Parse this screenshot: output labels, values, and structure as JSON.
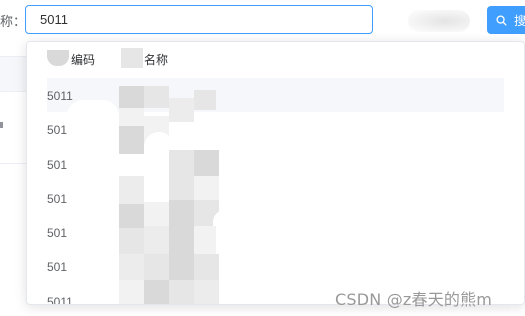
{
  "filter": {
    "label": "称：",
    "value": "5011",
    "search_button_label": "搜"
  },
  "dropdown": {
    "columns": {
      "code": "编码",
      "name": "名称"
    },
    "rows": [
      {
        "code": "5011"
      },
      {
        "code": "5011"
      },
      {
        "code": "5011"
      },
      {
        "code": "5011"
      },
      {
        "code": "5011"
      },
      {
        "code": "5011"
      },
      {
        "code": "5011"
      }
    ]
  },
  "watermark": "CSDN @z春天的熊m",
  "icons": {
    "search_button": "search-icon"
  },
  "colors": {
    "primary": "#409eff",
    "hover_row": "#f5f7fa"
  }
}
